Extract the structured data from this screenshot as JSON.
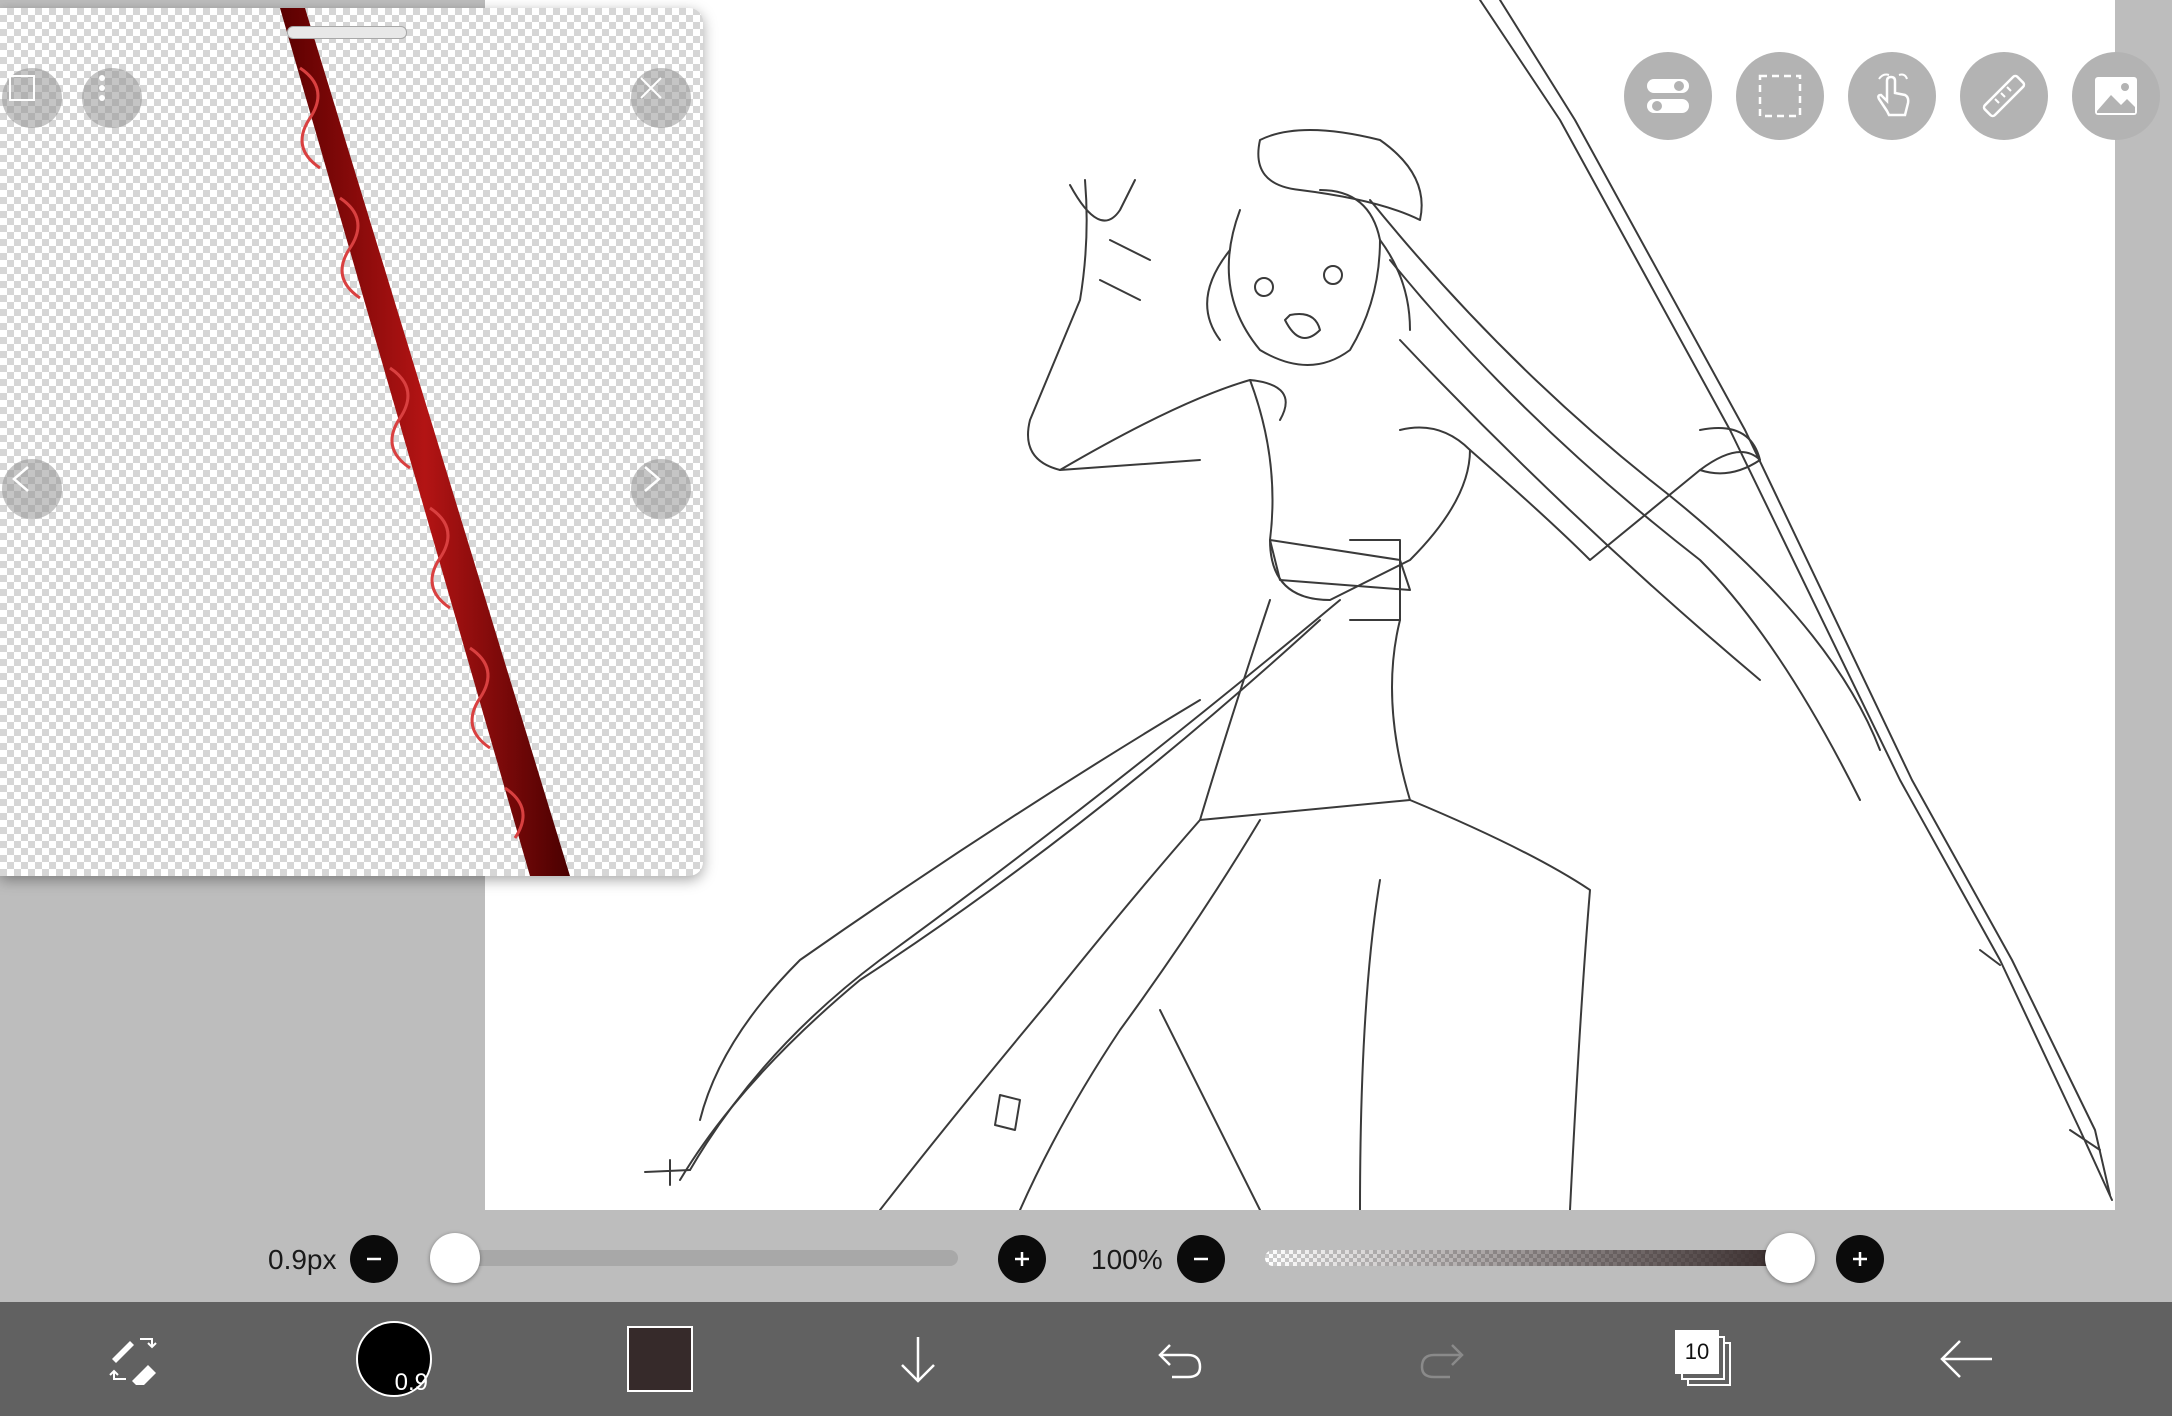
{
  "reference_window": {
    "close_icon": "close-icon",
    "prev_icon": "chevron-left-icon",
    "next_icon": "chevron-right-icon"
  },
  "top_tools": [
    "toggle-icon",
    "selection-icon",
    "touch-icon",
    "ruler-icon",
    "image-icon"
  ],
  "sliders": {
    "brush_size": {
      "label": "0.9px",
      "value_fraction": 0.0
    },
    "opacity": {
      "label": "100%",
      "value_fraction": 1.0
    }
  },
  "toolbar": {
    "brush_size_badge": "0.9",
    "layer_count": "10",
    "colors": {
      "current": "#362a2a",
      "toolbar_bg": "#616161"
    }
  }
}
